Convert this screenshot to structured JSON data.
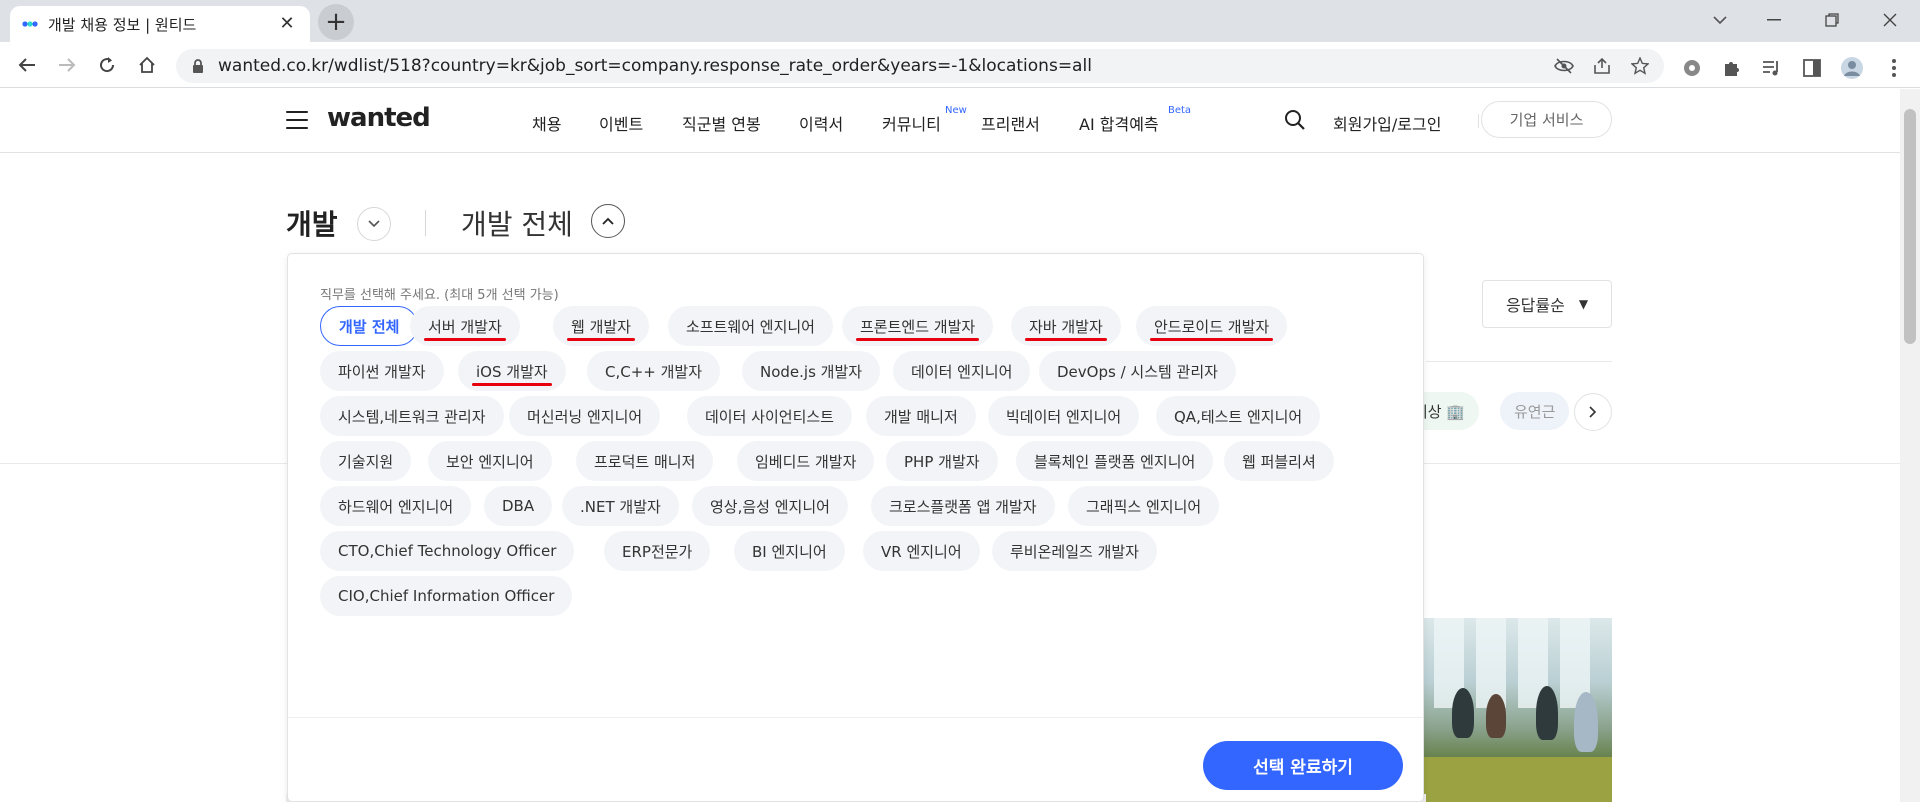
{
  "browser": {
    "tab_title": "개발 채용 정보 | 원티드",
    "url": "wanted.co.kr/wdlist/518?country=kr&job_sort=company.response_rate_order&years=-1&locations=all"
  },
  "gnb": {
    "logo": "wanted",
    "menu": [
      {
        "label": "채용"
      },
      {
        "label": "이벤트"
      },
      {
        "label": "직군별 연봉"
      },
      {
        "label": "이력서"
      },
      {
        "label": "커뮤니티",
        "badge": "New"
      },
      {
        "label": "프리랜서"
      },
      {
        "label": "AI 합격예측",
        "badge": "Beta"
      }
    ],
    "auth": "회원가입/로그인",
    "corp_button": "기업 서비스"
  },
  "header": {
    "category": "개발",
    "subcategory": "개발 전체"
  },
  "sort": {
    "label": "응답률순"
  },
  "tags": [
    {
      "label": "기상 🏢"
    },
    {
      "label": "유연근"
    }
  ],
  "panel": {
    "hint": "직무를 선택해 주세요. (최대 5개 선택 가능)",
    "chips": [
      {
        "label": "개발 전체",
        "selected": true
      },
      {
        "label": "서버 개발자",
        "marked": true
      },
      {
        "label": "웹 개발자",
        "marked": true
      },
      {
        "label": "소프트웨어 엔지니어"
      },
      {
        "label": "프론트엔드 개발자",
        "marked": true
      },
      {
        "label": "자바 개발자",
        "marked": true
      },
      {
        "label": "안드로이드 개발자",
        "marked": true
      },
      {
        "label": "파이썬 개발자"
      },
      {
        "label": "iOS 개발자",
        "marked": true
      },
      {
        "label": "C,C++ 개발자"
      },
      {
        "label": "Node.js 개발자"
      },
      {
        "label": "데이터 엔지니어"
      },
      {
        "label": "DevOps / 시스템 관리자"
      },
      {
        "label": "시스템,네트워크 관리자"
      },
      {
        "label": "머신러닝 엔지니어"
      },
      {
        "label": "데이터 사이언티스트"
      },
      {
        "label": "개발 매니저"
      },
      {
        "label": "빅데이터 엔지니어"
      },
      {
        "label": "QA,테스트 엔지니어"
      },
      {
        "label": "기술지원"
      },
      {
        "label": "보안 엔지니어"
      },
      {
        "label": "프로덕트 매니저"
      },
      {
        "label": "임베디드 개발자"
      },
      {
        "label": "PHP 개발자"
      },
      {
        "label": "블록체인 플랫폼 엔지니어"
      },
      {
        "label": "웹 퍼블리셔"
      },
      {
        "label": "하드웨어 엔지니어"
      },
      {
        "label": "DBA"
      },
      {
        "label": ".NET 개발자"
      },
      {
        "label": "영상,음성 엔지니어"
      },
      {
        "label": "크로스플랫폼 앱 개발자"
      },
      {
        "label": "그래픽스 엔지니어"
      },
      {
        "label": "CTO,Chief Technology Officer"
      },
      {
        "label": "ERP전문가"
      },
      {
        "label": "BI 엔지니어"
      },
      {
        "label": "VR 엔지니어"
      },
      {
        "label": "루비온레일즈 개발자"
      },
      {
        "label": "CIO,Chief Information Officer"
      }
    ],
    "done_button": "선택 완료하기"
  },
  "colors": {
    "accent": "#3366ff",
    "chip_bg": "#f2f4f7",
    "mark": "#e8000f"
  }
}
